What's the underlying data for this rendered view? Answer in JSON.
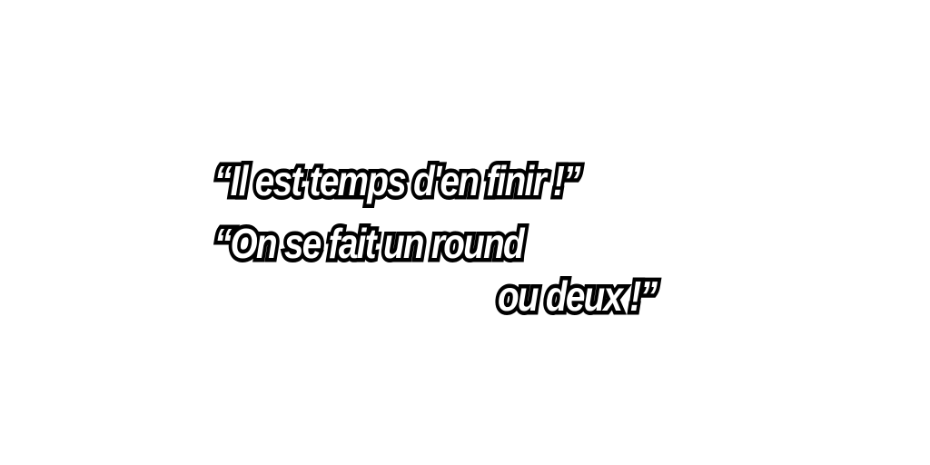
{
  "captions": {
    "line1": "“Il est temps d'en finir !”",
    "line2": "“On se fait un round",
    "line3": "ou deux !”"
  },
  "colors": {
    "background": "#ffffff",
    "text_fill": "#ffffff",
    "text_outline": "#000000"
  }
}
